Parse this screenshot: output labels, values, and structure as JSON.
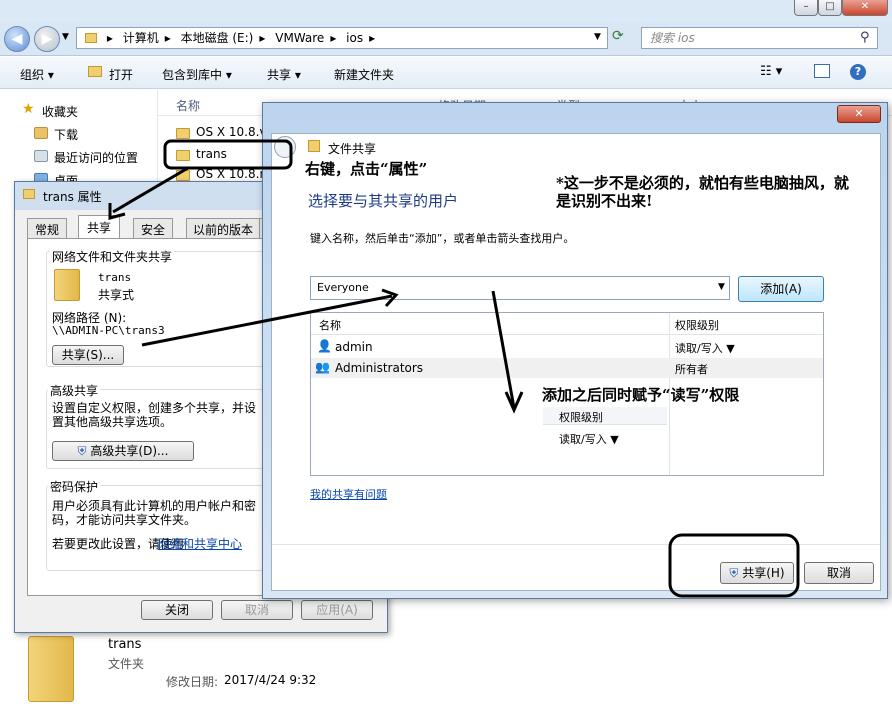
{
  "explorer": {
    "breadcrumb": [
      "计算机",
      "本地磁盘 (E:)",
      "VMWare",
      "ios"
    ],
    "search_placeholder": "搜索 ios",
    "toolbar": {
      "organize": "组织 ▾",
      "open": "打开",
      "include": "包含到库中 ▾",
      "share": "共享 ▾",
      "new_folder": "新建文件夹"
    },
    "nav": {
      "favorites": "收藏夹",
      "downloads": "下载",
      "recent": "最近访问的位置",
      "desktop": "桌面"
    },
    "columns": {
      "name": "名称",
      "modified": "修改日期",
      "type": "类型",
      "size": "大小"
    },
    "files": [
      "OS X 10.8.v",
      "trans",
      "OS X 10.8.n"
    ],
    "details": {
      "name": "trans",
      "type": "文件夹",
      "modified_label": "修改日期:",
      "modified_value": "2017/4/24 9:32"
    }
  },
  "props": {
    "title": "trans 属性",
    "tabs": [
      "常规",
      "共享",
      "安全",
      "以前的版本",
      "自"
    ],
    "section_net": "网络文件和文件夹共享",
    "folder_name": "trans",
    "folder_state": "共享式",
    "path_label": "网络路径 (N):",
    "path_value": "\\\\ADMIN-PC\\trans3",
    "share_btn": "共享(S)...",
    "section_adv": "高级共享",
    "adv_desc": "设置自定义权限，创建多个共享，并设置其他高级共享选项。",
    "adv_btn": "高级共享(D)...",
    "section_pwd": "密码保护",
    "pwd_desc": "用户必须具有此计算机的用户帐户和密码，才能访问共享文件夹。",
    "pwd_change_prefix": "若要更改此设置，请使用",
    "pwd_change_link": "网络和共享中心",
    "close": "关闭",
    "cancel": "取消",
    "apply": "应用(A)"
  },
  "share": {
    "title": "文件共享",
    "heading": "选择要与其共享的用户",
    "instruction": "键入名称，然后单击“添加”，或者单击箭头查找用户。",
    "input_value": "Everyone",
    "add_btn": "添加(A)",
    "col_name": "名称",
    "col_perm": "权限级别",
    "users": [
      {
        "name": "admin",
        "perm": "读取/写入 ▼"
      },
      {
        "name": "Administrators",
        "perm": "所有者"
      }
    ],
    "popup_header": "权限级别",
    "popup_value": "读取/写入 ▼",
    "trouble_link": "我的共享有问题",
    "share_btn": "共享(H)",
    "cancel_btn": "取消",
    "close_glyph": "✕"
  },
  "annotations": {
    "a1": "右键，点击“属性”",
    "a2_line1": "*这一步不是必须的，就怕有些电脑抽风，就",
    "a2_line2": "是识别不出来!",
    "a3": "添加之后同时赋予“读写”权限"
  }
}
